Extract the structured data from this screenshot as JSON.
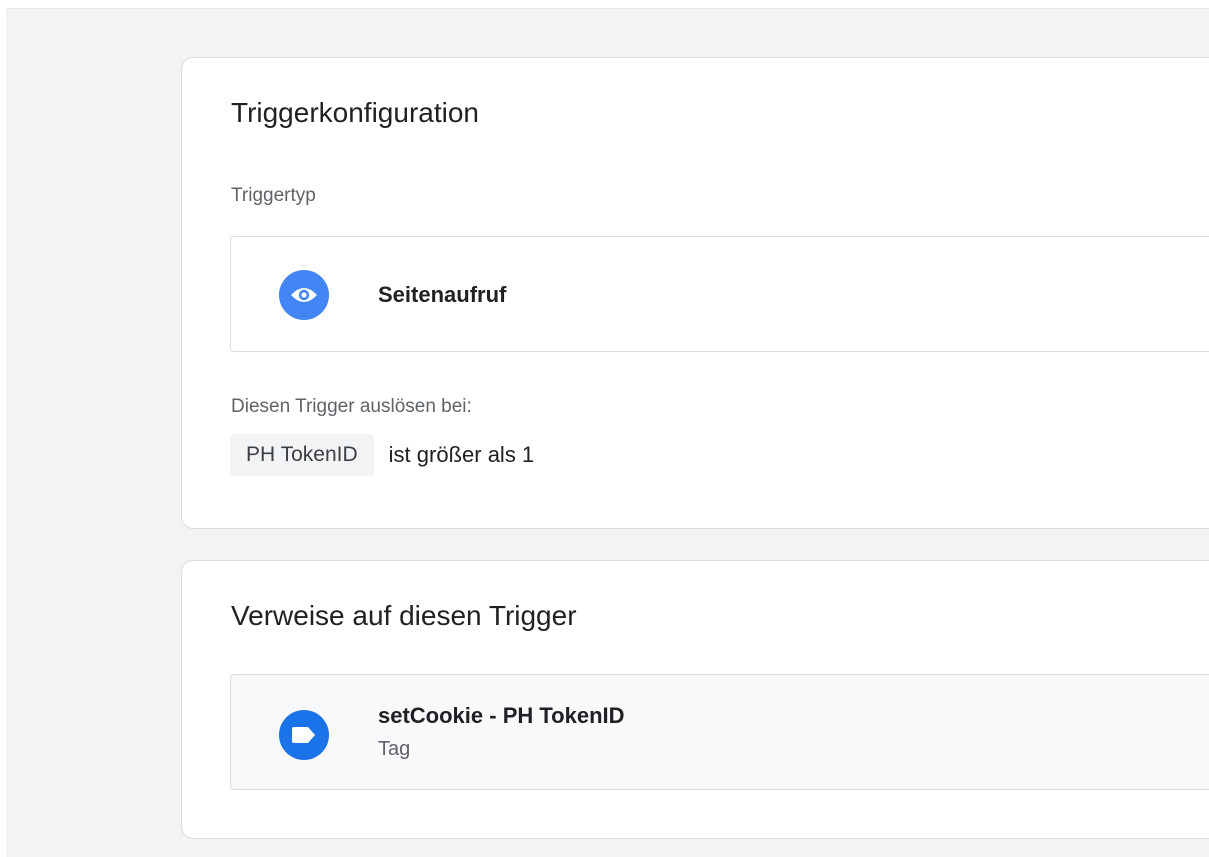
{
  "trigger_config": {
    "title": "Triggerkonfiguration",
    "type_label": "Triggertyp",
    "type": {
      "icon": "eye-icon",
      "name": "Seitenaufruf"
    },
    "fire_label": "Diesen Trigger auslösen bei:",
    "condition": {
      "variable": "PH TokenID",
      "operator_text": "ist größer als 1"
    }
  },
  "references": {
    "title": "Verweise auf diesen Trigger",
    "items": [
      {
        "icon": "tag-icon",
        "name": "setCookie - PH TokenID",
        "kind": "Tag"
      }
    ]
  },
  "colors": {
    "background": "#f1f3f4",
    "card": "#ffffff",
    "accent": "#4285f4",
    "tag_accent": "#1a73e8",
    "muted_text": "#5f6368"
  }
}
